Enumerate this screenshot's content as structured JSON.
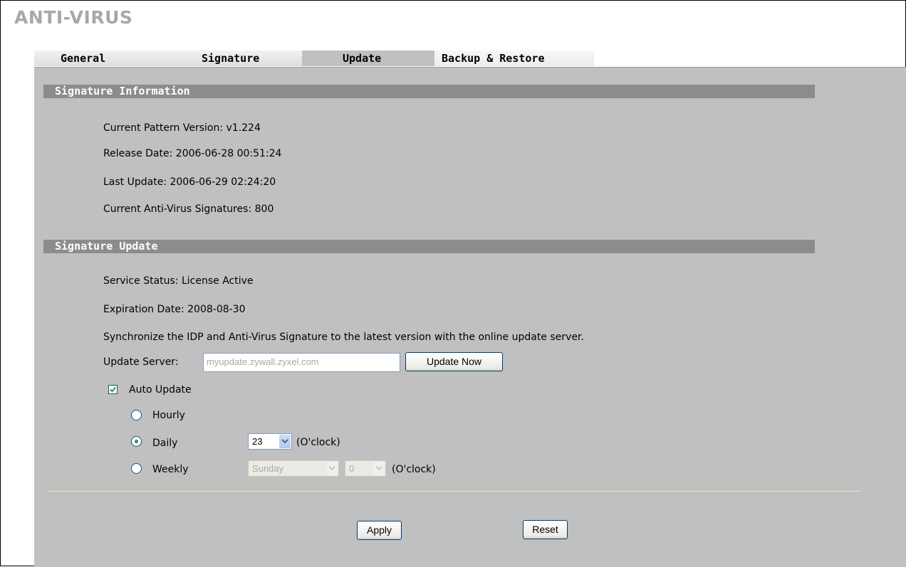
{
  "page_title": "ANTI-VIRUS",
  "tabs": [
    {
      "label": "General"
    },
    {
      "label": "Signature"
    },
    {
      "label": "Update"
    },
    {
      "label": "Backup & Restore"
    }
  ],
  "signature_info": {
    "header": "Signature Information",
    "current_pattern_version": "Current Pattern Version: v1.224",
    "release_date": "Release Date: 2006-06-28 00:51:24",
    "last_update": "Last Update: 2006-06-29 02:24:20",
    "current_signatures": "Current Anti-Virus Signatures: 800"
  },
  "signature_update": {
    "header": "Signature Update",
    "service_status": "Service Status: License Active",
    "expiration_date": "Expiration Date: 2008-08-30",
    "sync_text": "Synchronize the IDP and Anti-Virus Signature to the latest version with the online update server.",
    "update_server_label": "Update Server:",
    "update_server_value": "myupdate.zywall.zyxel.com",
    "update_now_label": "Update Now",
    "auto_update_label": "Auto Update",
    "auto_update_checked": true,
    "hourly_label": "Hourly",
    "daily_label": "Daily",
    "weekly_label": "Weekly",
    "selected_schedule": "Daily",
    "daily_hour": "23",
    "oclock_label": "(O'clock)",
    "weekly_day": "Sunday",
    "weekly_hour": "0"
  },
  "buttons": {
    "apply": "Apply",
    "reset": "Reset"
  },
  "colors": {
    "panel_bg": "#c0c0c0",
    "section_bar": "#8c8c8c",
    "title_gray": "#a8a8a8"
  }
}
